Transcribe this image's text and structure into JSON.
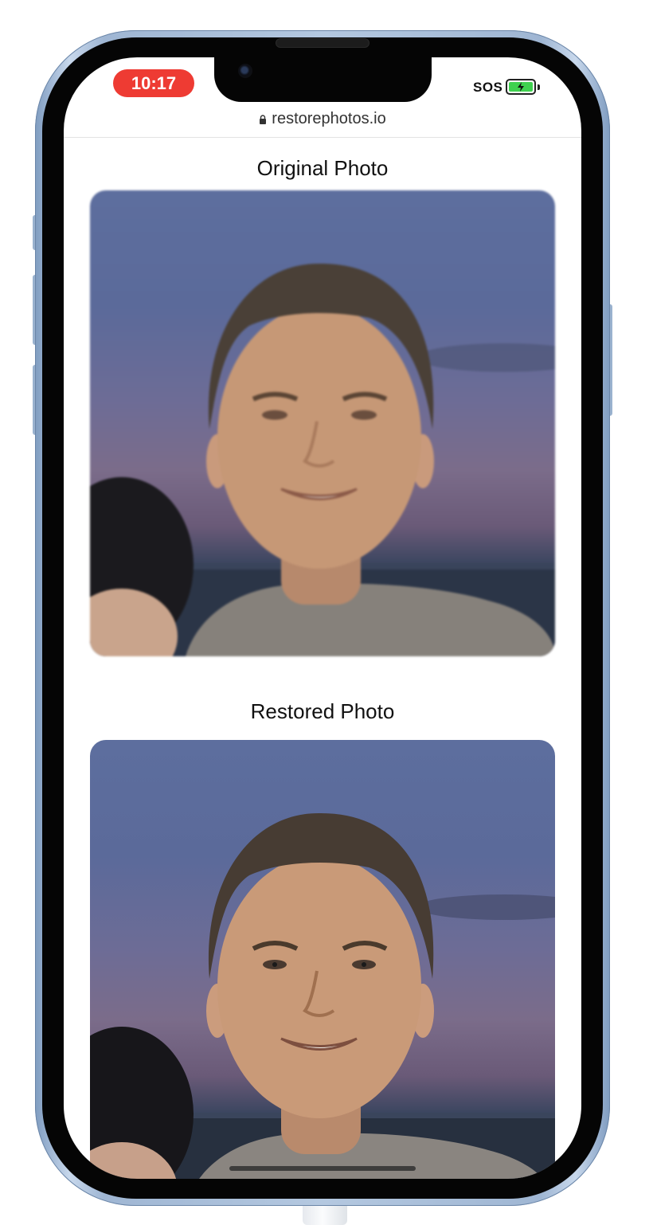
{
  "status_bar": {
    "time": "10:17",
    "signal_text": "SOS",
    "battery_icon": "battery-charging-icon",
    "time_pill_color": "#ee3b33",
    "battery_color": "#3fd14f"
  },
  "browser": {
    "url": "restorephotos.io",
    "lock_icon": "lock-icon"
  },
  "page": {
    "original_title": "Original Photo",
    "restored_title": "Restored Photo"
  }
}
